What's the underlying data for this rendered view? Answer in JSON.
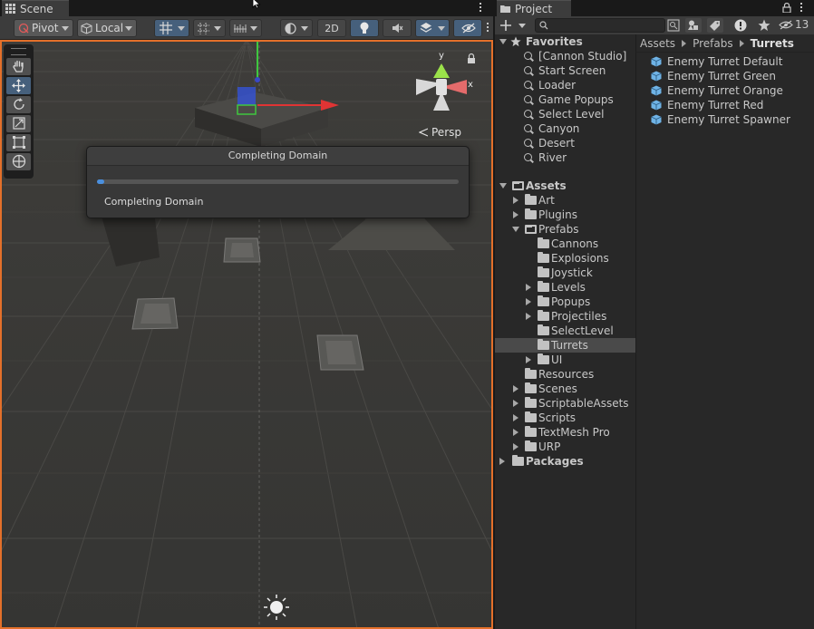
{
  "scene": {
    "tab_label": "Scene",
    "toolbar": {
      "pivot": "Pivot",
      "local": "Local",
      "mode_2d": "2D"
    },
    "persp_label": "Persp",
    "gizmo": {
      "y": "y",
      "x": "x"
    }
  },
  "dialog": {
    "title": "Completing Domain",
    "message": "Completing Domain",
    "progress": 0.02
  },
  "project": {
    "tab_label": "Project",
    "hidden_count": "13",
    "favorites": {
      "label": "Favorites",
      "items": [
        "[Cannon Studio]",
        "Start Screen",
        "Loader",
        "Game Popups",
        "Select Level",
        "Canyon",
        "Desert",
        "River"
      ]
    },
    "assets": {
      "label": "Assets",
      "items": [
        {
          "label": "Art",
          "indent": 1,
          "arrow": "right"
        },
        {
          "label": "Plugins",
          "indent": 1,
          "arrow": "right"
        },
        {
          "label": "Prefabs",
          "indent": 1,
          "arrow": "down"
        },
        {
          "label": "Cannons",
          "indent": 2,
          "arrow": "none"
        },
        {
          "label": "Explosions",
          "indent": 2,
          "arrow": "none"
        },
        {
          "label": "Joystick",
          "indent": 2,
          "arrow": "none"
        },
        {
          "label": "Levels",
          "indent": 2,
          "arrow": "right"
        },
        {
          "label": "Popups",
          "indent": 2,
          "arrow": "right"
        },
        {
          "label": "Projectiles",
          "indent": 2,
          "arrow": "right"
        },
        {
          "label": "SelectLevel",
          "indent": 2,
          "arrow": "none"
        },
        {
          "label": "Turrets",
          "indent": 2,
          "arrow": "none",
          "selected": true
        },
        {
          "label": "UI",
          "indent": 2,
          "arrow": "right"
        },
        {
          "label": "Resources",
          "indent": 1,
          "arrow": "none"
        },
        {
          "label": "Scenes",
          "indent": 1,
          "arrow": "right"
        },
        {
          "label": "ScriptableAssets",
          "indent": 1,
          "arrow": "right"
        },
        {
          "label": "Scripts",
          "indent": 1,
          "arrow": "right"
        },
        {
          "label": "TextMesh Pro",
          "indent": 1,
          "arrow": "right"
        },
        {
          "label": "URP",
          "indent": 1,
          "arrow": "right"
        }
      ]
    },
    "packages_label": "Packages",
    "breadcrumb": [
      "Assets",
      "Prefabs",
      "Turrets"
    ],
    "content_items": [
      "Enemy Turret Default",
      "Enemy Turret Green",
      "Enemy Turret Orange",
      "Enemy Turret Red",
      "Enemy Turret Spawner"
    ]
  },
  "colors": {
    "accent_orange": "#e4702a",
    "selection_blue": "#46607c",
    "progress_blue": "#4a8fde"
  }
}
